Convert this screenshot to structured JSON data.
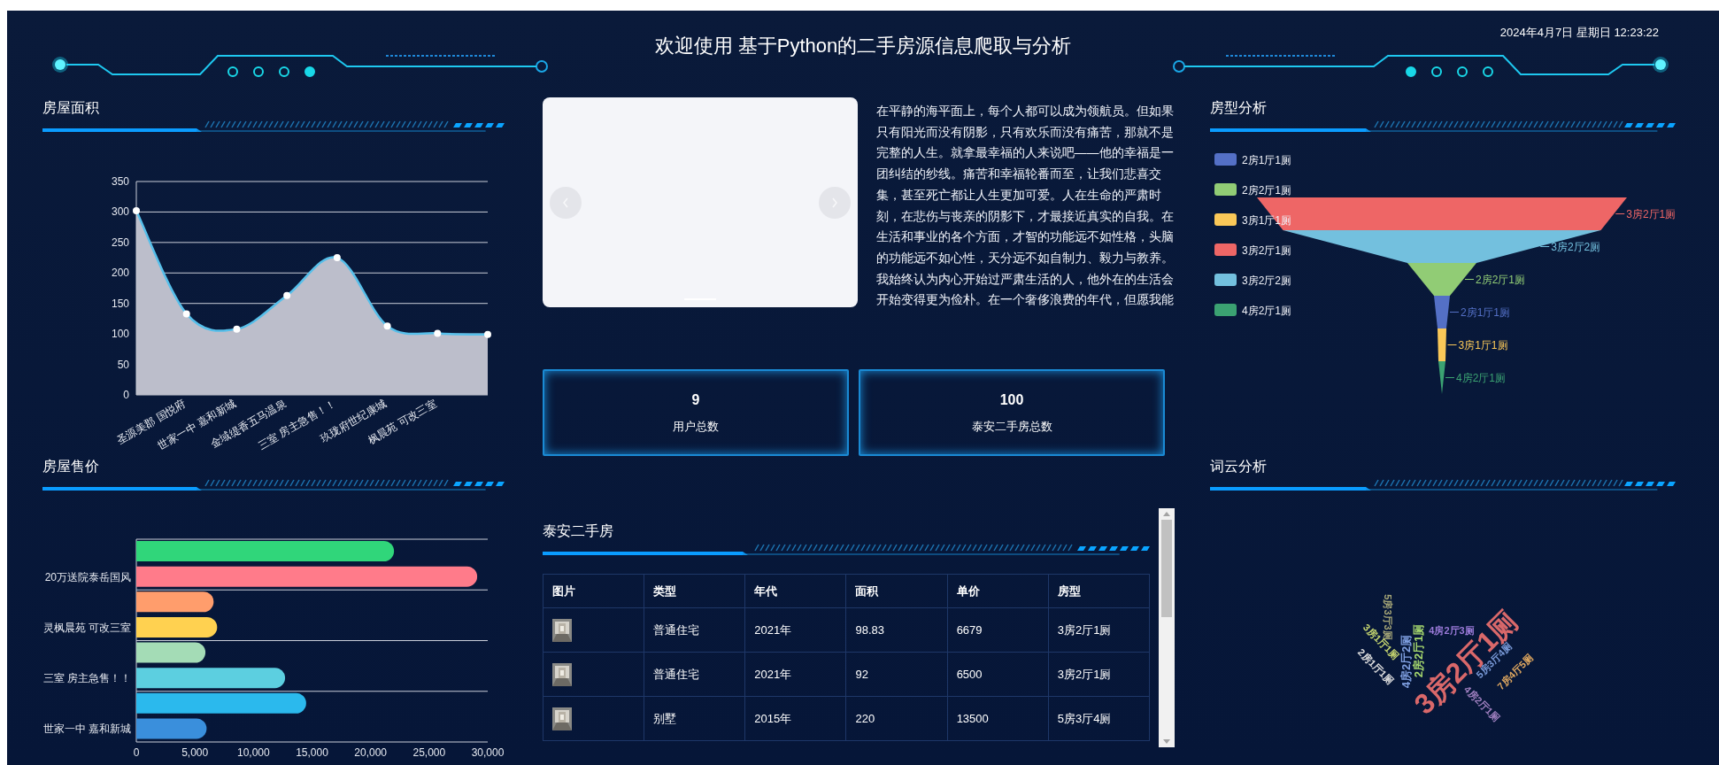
{
  "header": {
    "title": "欢迎使用 基于Python的二手房源信息爬取与分析",
    "datetime": "2024年4月7日 星期日 12:23:22"
  },
  "area_panel": {
    "title": "房屋面积",
    "chart_data": {
      "type": "area",
      "categories": [
        null,
        "圣源美郡 国悦府",
        "世家一中 嘉和新城",
        "金域缇香五马温泉",
        "三室  房主急售！！",
        "玖珑府世纪康城",
        "枫晨苑 可改三室",
        null
      ],
      "series": [
        {
          "color": "#bcbecb",
          "values": [
            302,
            133,
            108,
            163,
            225,
            113,
            101,
            99
          ]
        }
      ],
      "ylim": [
        0,
        350
      ],
      "yticks": [
        0,
        50,
        100,
        150,
        200,
        250,
        300,
        350
      ],
      "grid": true
    }
  },
  "price_panel": {
    "title": "房屋售价",
    "chart_data": {
      "type": "bar",
      "orientation": "horizontal",
      "categories": [
        "20万送院泰岳国风",
        "灵枫晨苑 可改三室",
        "三室  房主急售！！",
        "世家一中 嘉和新城"
      ],
      "series": [
        {
          "values": [
            29100,
            6900,
            12700,
            6000
          ],
          "colors": [
            "#ff7b8a",
            "#ffd150",
            "#5ccfe0",
            "#3a8fdc"
          ]
        },
        {
          "values": [
            22000,
            6600,
            5900,
            14500
          ],
          "colors": [
            "#30d67a",
            "#ff9d6c",
            "#a4dcb6",
            "#2bb9ed"
          ]
        }
      ],
      "grid": true,
      "xlim": [
        0,
        30000
      ],
      "xticks": [
        {
          "value": 0,
          "label": "0"
        },
        {
          "value": 5000,
          "label": "5,000"
        },
        {
          "value": 10000,
          "label": "10,000"
        },
        {
          "value": 15000,
          "label": "15,000"
        },
        {
          "value": 20000,
          "label": "20,000"
        },
        {
          "value": 25000,
          "label": "25,000"
        },
        {
          "value": 30000,
          "label": "30,000"
        }
      ]
    }
  },
  "intro": {
    "text": "在平静的海平面上，每个人都可以成为领航员。但如果只有阳光而没有阴影，只有欢乐而没有痛苦，那就不是完整的人生。就拿最幸福的人来说吧——他的幸福是一团纠结的纱线。痛苦和幸福轮番而至，让我们悲喜交集，甚至死亡都让人生更加可爱。人在生命的严肃时刻，在悲伤与丧亲的阴影下，才最接近真实的自我。在生活和事业的各个方面，才智的功能远不如性格，头脑的功能远不如心性，天分远不如自制力、毅力与教养。我始终认为内心开始过严肃生活的人，他外在的生活会开始变得更为俭朴。在一个奢侈浪费的年代，但愿我能"
  },
  "stats": [
    {
      "value": "9",
      "label": "用户总数"
    },
    {
      "value": "100",
      "label": "泰安二手房总数"
    }
  ],
  "listing_panel": {
    "title": "泰安二手房",
    "columns": [
      "图片",
      "类型",
      "年代",
      "面积",
      "单价",
      "房型"
    ],
    "rows": [
      {
        "cells": [
          {
            "kind": "picture"
          },
          "普通住宅",
          "2021年",
          "98.83",
          "6679",
          "3房2厅1厕"
        ]
      },
      {
        "cells": [
          {
            "kind": "picture"
          },
          "普通住宅",
          "2021年",
          "92",
          "6500",
          "3房2厅1厕"
        ]
      },
      {
        "cells": [
          {
            "kind": "picture"
          },
          "别墅",
          "2015年",
          "220",
          "13500",
          "5房3厅4厕"
        ]
      }
    ]
  },
  "house_type_panel": {
    "title": "房型分析",
    "legend": [
      {
        "label": "2房1厅1厕",
        "color": "#5470c6"
      },
      {
        "label": "2房2厅1厕",
        "color": "#91cc75"
      },
      {
        "label": "3房1厅1厕",
        "color": "#fac858"
      },
      {
        "label": "3房2厅1厕",
        "color": "#ee6666"
      },
      {
        "label": "3房2厅2厕",
        "color": "#73c0de"
      },
      {
        "label": "4房2厅1厕",
        "color": "#3ba272"
      }
    ],
    "funnel": [
      {
        "label": "3房2厅1厕",
        "color": "#ee6666"
      },
      {
        "label": "3房2厅2厕",
        "color": "#73c0de"
      },
      {
        "label": "2房2厅1厕",
        "color": "#91cc75"
      },
      {
        "label": "2房1厅1厕",
        "color": "#5470c6"
      },
      {
        "label": "3房1厅1厕",
        "color": "#fac858"
      },
      {
        "label": "4房2厅1厕",
        "color": "#3ba272"
      }
    ]
  },
  "word_cloud_panel": {
    "title": "词云分析",
    "words": [
      {
        "text": "3房2厅1厕",
        "color": "#d9686a"
      },
      {
        "text": "2房2厅1厕",
        "color": "#a6d86e"
      },
      {
        "text": "4房2厅2厕",
        "color": "#7f9fe0"
      },
      {
        "text": "4房2厅3厕",
        "color": "#9a7ad8"
      },
      {
        "text": "5房3厅3厕",
        "color": "#a8a878"
      },
      {
        "text": "3房1厅1厕",
        "color": "#c8d870"
      },
      {
        "text": "2房1厅1厕",
        "color": "#e0e0e0"
      },
      {
        "text": "5房3厅4厕",
        "color": "#7a9ad8"
      },
      {
        "text": "7房4厅5厕",
        "color": "#e0a860"
      },
      {
        "text": "4房2厅1厕",
        "color": "#a080c0"
      }
    ]
  }
}
